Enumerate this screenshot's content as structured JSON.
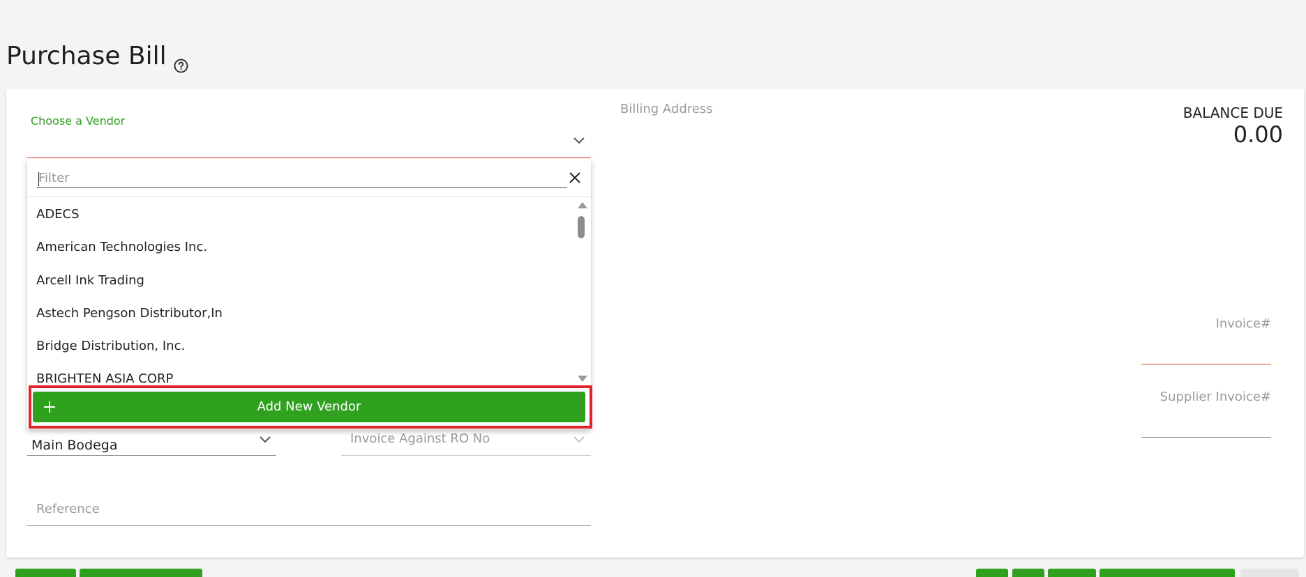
{
  "page": {
    "title": "Purchase Bill",
    "help_icon": "question-circle-icon"
  },
  "vendor": {
    "label": "Choose a Vendor",
    "chevron_icon": "chevron-down-icon",
    "dropdown": {
      "filter_placeholder": "Filter",
      "filter_value": "",
      "close_icon": "close-icon",
      "items": [
        "ADECS",
        "American Technologies Inc.",
        "Arcell Ink Trading",
        "Astech Pengson Distributor,In",
        "Bridge Distribution, Inc.",
        "BRIGHTEN ASIA CORP"
      ],
      "add_button_label": "Add New Vendor",
      "add_button_icon": "plus-icon"
    }
  },
  "billing": {
    "label": "Billing Address"
  },
  "balance": {
    "label": "BALANCE DUE",
    "value": "0.00"
  },
  "invoice": {
    "label": "Invoice#",
    "supplier_label": "Supplier Invoice#"
  },
  "warehouse": {
    "value": "Main Bodega"
  },
  "ro": {
    "placeholder": "Invoice Against RO No"
  },
  "reference": {
    "placeholder": "Reference"
  },
  "colors": {
    "accent_green": "#2fa11f",
    "error_red": "#e24b2e",
    "highlight_red": "#e0242a"
  }
}
